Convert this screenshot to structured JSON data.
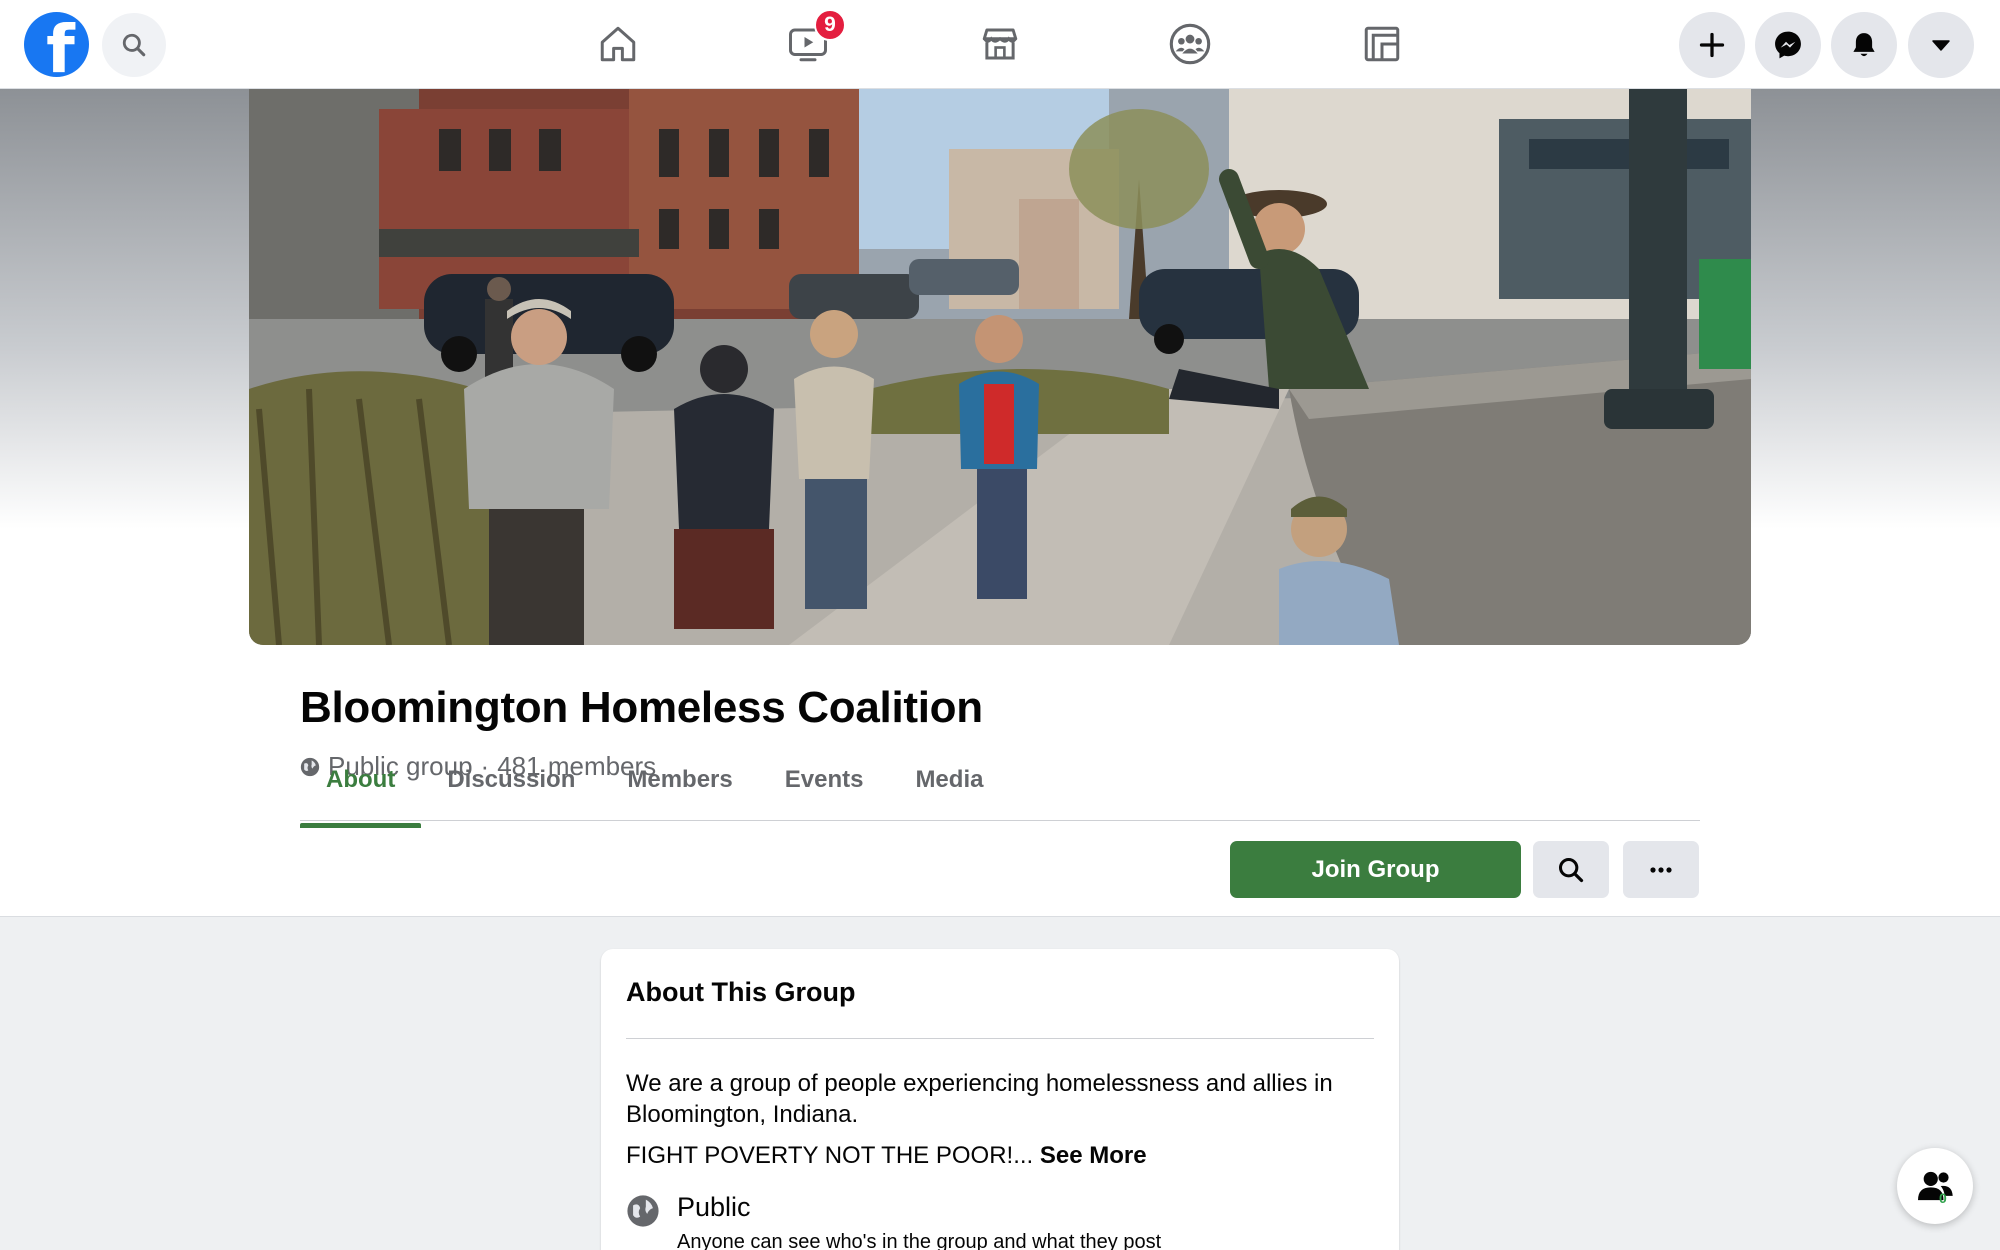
{
  "nav": {
    "logo_letter": "f",
    "watch_badge": "9"
  },
  "group": {
    "name": "Bloomington Homeless Coalition",
    "privacy": "Public group",
    "separator": "·",
    "members": "481 members"
  },
  "tabs": [
    "About",
    "Discussion",
    "Members",
    "Events",
    "Media"
  ],
  "active_tab": "About",
  "actions": {
    "join_label": "Join Group",
    "more_label": "···"
  },
  "about": {
    "title": "About This Group",
    "description": "We are a group of people experiencing homelessness and allies in Bloomington, Indiana.",
    "description2": "FIGHT POVERTY NOT THE POOR!...",
    "see_more": "See More",
    "privacy_title": "Public",
    "privacy_desc": "Anyone can see who's in the group and what they post"
  },
  "chat": {
    "count": "0"
  },
  "colors": {
    "brand_blue": "#1877f2",
    "group_green": "#3b7d3f",
    "badge_red": "#e41e3f"
  }
}
